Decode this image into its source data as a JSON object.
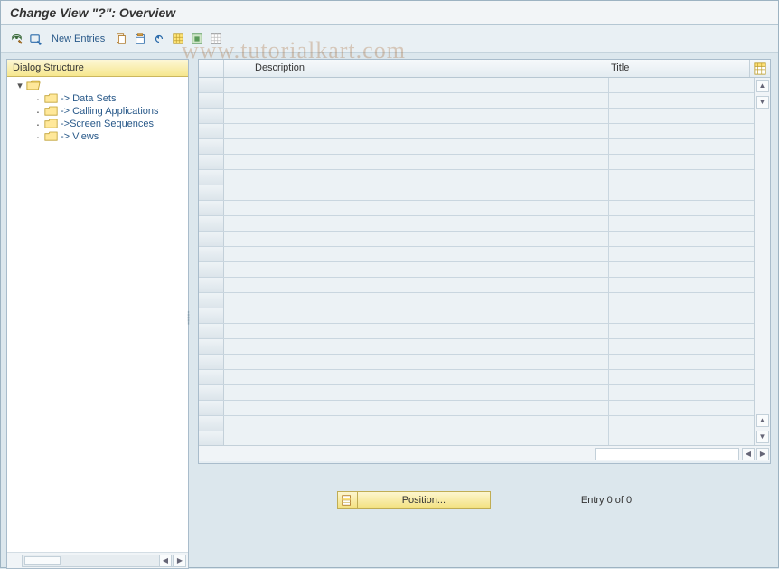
{
  "header": {
    "title": "Change View \"?\": Overview"
  },
  "toolbar": {
    "new_entries_label": "New Entries"
  },
  "sidebar": {
    "header": "Dialog Structure",
    "root_label": "",
    "items": [
      "-> Data Sets",
      "-> Calling Applications",
      "->Screen Sequences",
      "-> Views"
    ]
  },
  "grid": {
    "columns": {
      "description": "Description",
      "title": "Title"
    },
    "row_count": 24
  },
  "footer": {
    "position_label": "Position...",
    "entry_text": "Entry 0 of 0"
  },
  "watermark": "www.tutorialkart.com"
}
